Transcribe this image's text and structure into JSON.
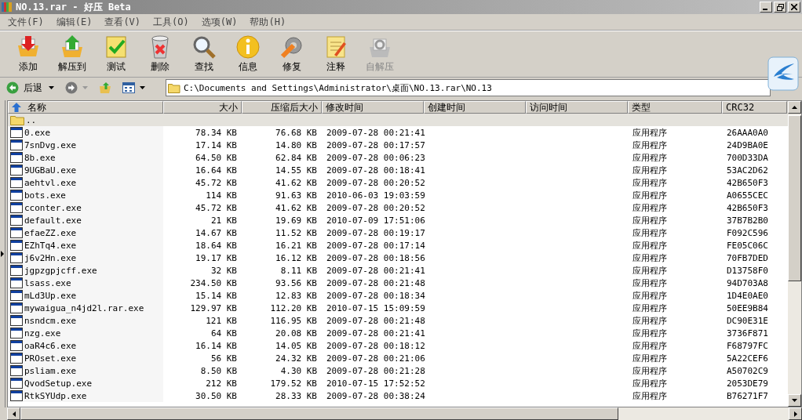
{
  "window": {
    "title": "NO.13.rar - 好压 Beta"
  },
  "menu": [
    "文件(F)",
    "编辑(E)",
    "查看(V)",
    "工具(O)",
    "选项(W)",
    "帮助(H)"
  ],
  "toolbar": [
    {
      "label": "添加",
      "disabled": false
    },
    {
      "label": "解压到",
      "disabled": false
    },
    {
      "label": "测试",
      "disabled": false
    },
    {
      "label": "删除",
      "disabled": false
    },
    {
      "label": "查找",
      "disabled": false
    },
    {
      "label": "信息",
      "disabled": false
    },
    {
      "label": "修复",
      "disabled": false
    },
    {
      "label": "注释",
      "disabled": false
    },
    {
      "label": "自解压",
      "disabled": true
    }
  ],
  "nav": {
    "back": "后退",
    "address": "C:\\Documents and Settings\\Administrator\\桌面\\NO.13.rar\\NO.13"
  },
  "columns": [
    {
      "label": "名称",
      "sorted": true
    },
    {
      "label": "大小",
      "sorted": false
    },
    {
      "label": "压缩后大小",
      "sorted": false
    },
    {
      "label": "修改时间",
      "sorted": false
    },
    {
      "label": "创建时间",
      "sorted": false
    },
    {
      "label": "访问时间",
      "sorted": false
    },
    {
      "label": "类型",
      "sorted": false
    },
    {
      "label": "CRC32",
      "sorted": false
    }
  ],
  "rows": [
    {
      "kind": "parent",
      "cells": [
        ".."
      ]
    },
    {
      "kind": "file",
      "cells": [
        "0.exe",
        "78.34 KB",
        "76.68 KB",
        "2009-07-28 00:21:41",
        "",
        "",
        "应用程序",
        "26AAA0A0"
      ]
    },
    {
      "kind": "file",
      "cells": [
        "7snDvg.exe",
        "17.14 KB",
        "14.80 KB",
        "2009-07-28 00:17:57",
        "",
        "",
        "应用程序",
        "24D9BA0E"
      ]
    },
    {
      "kind": "file",
      "cells": [
        "8b.exe",
        "64.50 KB",
        "62.84 KB",
        "2009-07-28 00:06:23",
        "",
        "",
        "应用程序",
        "700D33DA"
      ]
    },
    {
      "kind": "file",
      "cells": [
        "9UGBaU.exe",
        "16.64 KB",
        "14.55 KB",
        "2009-07-28 00:18:41",
        "",
        "",
        "应用程序",
        "53AC2D62"
      ]
    },
    {
      "kind": "file",
      "cells": [
        "aehtvl.exe",
        "45.72 KB",
        "41.62 KB",
        "2009-07-28 00:20:52",
        "",
        "",
        "应用程序",
        "42B650F3"
      ]
    },
    {
      "kind": "file",
      "cells": [
        "bots.exe",
        "114 KB",
        "91.63 KB",
        "2010-06-03 19:03:59",
        "",
        "",
        "应用程序",
        "A0655CEC"
      ]
    },
    {
      "kind": "file",
      "cells": [
        "cconter.exe",
        "45.72 KB",
        "41.62 KB",
        "2009-07-28 00:20:52",
        "",
        "",
        "应用程序",
        "42B650F3"
      ]
    },
    {
      "kind": "file",
      "cells": [
        "default.exe",
        "21 KB",
        "19.69 KB",
        "2010-07-09 17:51:06",
        "",
        "",
        "应用程序",
        "37B7B2B0"
      ]
    },
    {
      "kind": "file",
      "cells": [
        "efaeZZ.exe",
        "14.67 KB",
        "11.52 KB",
        "2009-07-28 00:19:17",
        "",
        "",
        "应用程序",
        "F092C596"
      ]
    },
    {
      "kind": "file",
      "cells": [
        "EZhTq4.exe",
        "18.64 KB",
        "16.21 KB",
        "2009-07-28 00:17:14",
        "",
        "",
        "应用程序",
        "FE05C06C"
      ]
    },
    {
      "kind": "file",
      "cells": [
        "j6v2Hn.exe",
        "19.17 KB",
        "16.12 KB",
        "2009-07-28 00:18:56",
        "",
        "",
        "应用程序",
        "70FB7DED"
      ]
    },
    {
      "kind": "file",
      "cells": [
        "jgpzgpjcff.exe",
        "32 KB",
        "8.11 KB",
        "2009-07-28 00:21:41",
        "",
        "",
        "应用程序",
        "D13758F0"
      ]
    },
    {
      "kind": "file",
      "cells": [
        "lsass.exe",
        "234.50 KB",
        "93.56 KB",
        "2009-07-28 00:21:48",
        "",
        "",
        "应用程序",
        "94D703A8"
      ]
    },
    {
      "kind": "file",
      "cells": [
        "mLd3Up.exe",
        "15.14 KB",
        "12.83 KB",
        "2009-07-28 00:18:34",
        "",
        "",
        "应用程序",
        "1D4E0AE0"
      ]
    },
    {
      "kind": "file",
      "cells": [
        "mywaigua_n4jd2l.rar.exe",
        "129.97 KB",
        "112.20 KB",
        "2010-07-15 15:09:59",
        "",
        "",
        "应用程序",
        "50EE9B84"
      ]
    },
    {
      "kind": "file",
      "cells": [
        "nsndcm.exe",
        "121 KB",
        "116.95 KB",
        "2009-07-28 00:21:48",
        "",
        "",
        "应用程序",
        "DC90E31E"
      ]
    },
    {
      "kind": "file",
      "cells": [
        "nzg.exe",
        "64 KB",
        "20.08 KB",
        "2009-07-28 00:21:41",
        "",
        "",
        "应用程序",
        "3736F871"
      ]
    },
    {
      "kind": "file",
      "cells": [
        "oaR4c6.exe",
        "16.14 KB",
        "14.05 KB",
        "2009-07-28 00:18:12",
        "",
        "",
        "应用程序",
        "F68797FC"
      ]
    },
    {
      "kind": "file",
      "cells": [
        "PROset.exe",
        "56 KB",
        "24.32 KB",
        "2009-07-28 00:21:06",
        "",
        "",
        "应用程序",
        "5A22CEF6"
      ]
    },
    {
      "kind": "file",
      "cells": [
        "psliam.exe",
        "8.50 KB",
        "4.30 KB",
        "2009-07-28 00:21:28",
        "",
        "",
        "应用程序",
        "A50702C9"
      ]
    },
    {
      "kind": "file",
      "cells": [
        "QvodSetup.exe",
        "212 KB",
        "179.52 KB",
        "2010-07-15 17:52:52",
        "",
        "",
        "应用程序",
        "2053DE79"
      ]
    },
    {
      "kind": "file",
      "cells": [
        "RtkSYUdp.exe",
        "30.50 KB",
        "28.33 KB",
        "2009-07-28 00:38:24",
        "",
        "",
        "应用程序",
        "B76271F7"
      ]
    }
  ]
}
